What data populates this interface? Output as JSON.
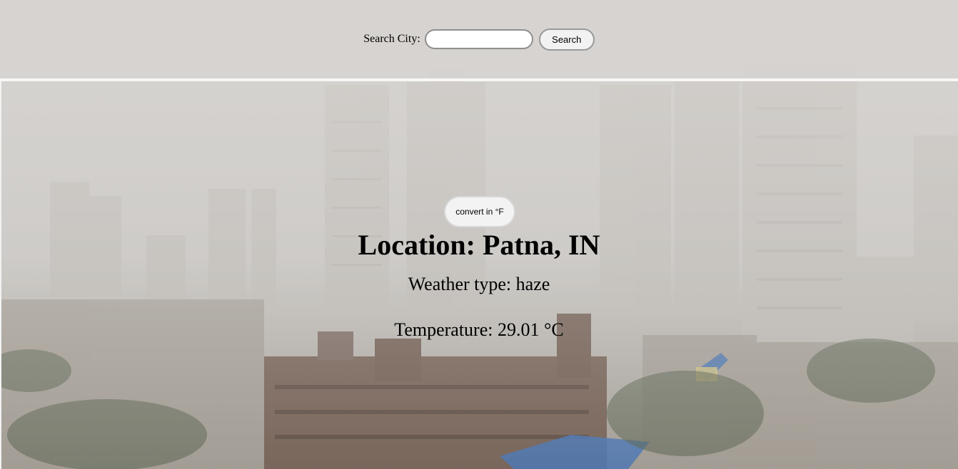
{
  "search": {
    "label": "Search City:",
    "input_value": "",
    "input_placeholder": "",
    "button_label": "Search"
  },
  "weather": {
    "convert_label": "convert in °F",
    "location_text": "Location: Patna, IN",
    "weather_type_text": "Weather type: haze",
    "temperature_text": "Temperature: 29.01 °C"
  },
  "background": {
    "scene": "hazy-city-skyline",
    "haze_color": "#d6d3d0",
    "building_color": "#b9b5b0",
    "roof_color": "#6f5a4e",
    "accent_blue": "#3f6fb0"
  }
}
